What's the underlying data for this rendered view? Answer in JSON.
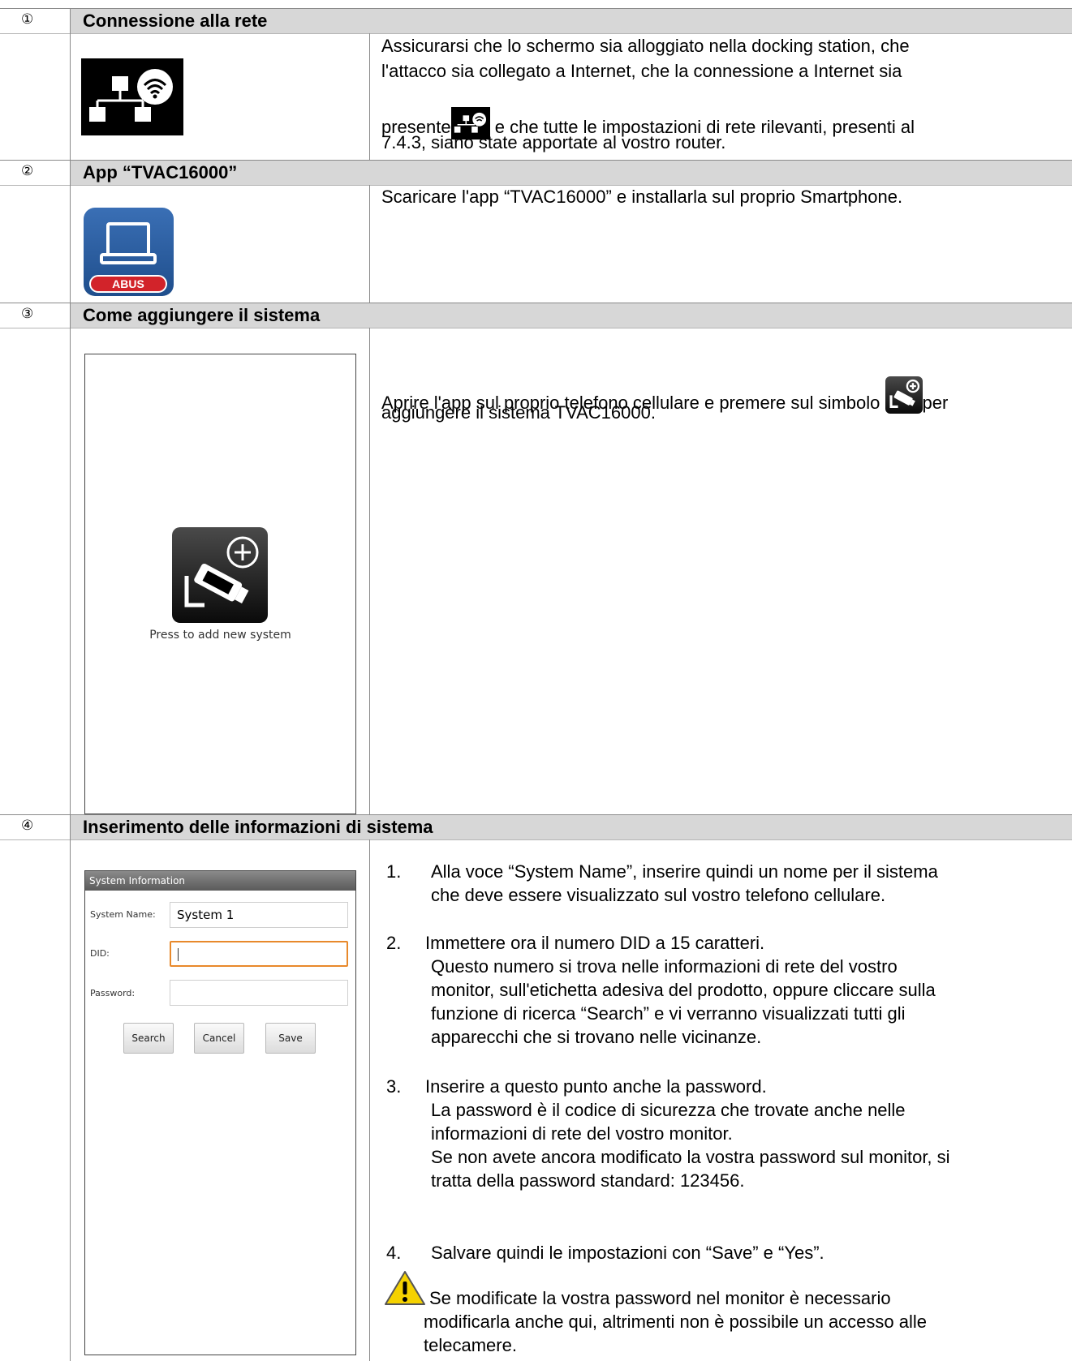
{
  "sections": [
    {
      "number": "①",
      "title": "Connessione alla rete",
      "text_line1": "Assicurarsi che lo schermo sia alloggiato nella docking station, che",
      "text_line2": "l'attacco sia collegato a Internet, che la connessione a Internet sia",
      "text_before_icon": "presente",
      "text_after_icon": " e che tutte le impostazioni di rete rilevanti, presenti al",
      "text_line4": "7.4.3, siano state apportate al vostro router.",
      "icon": "network-wifi-icon"
    },
    {
      "number": "②",
      "title": "App “TVAC16000”",
      "text": "Scaricare l'app “TVAC16000” e installarla sul proprio Smartphone.",
      "icon": "abus-app-icon",
      "app_logo_text": "ABUS"
    },
    {
      "number": "③",
      "title": "Come aggiungere il sistema",
      "text_before_icon": "Aprire l'app sul proprio telefono cellulare e premere sul simbolo ",
      "text_after_icon": "per",
      "text_line2": "aggiungere il sistema TVAC16000.",
      "app_add_label": "Press to add new system",
      "icon": "add-camera-icon"
    },
    {
      "number": "④",
      "title": "Inserimento delle informazioni di sistema",
      "app_form": {
        "title": "System Information",
        "system_name_label": "System Name:",
        "system_name_value": "System 1",
        "did_label": "DID:",
        "did_value": "",
        "password_label": "Password:",
        "password_value": "",
        "search_button": "Search",
        "cancel_button": "Cancel",
        "save_button": "Save"
      },
      "steps": [
        {
          "number": "1.",
          "lines": [
            "Alla voce “System Name”, inserire quindi un nome per il sistema",
            "che deve essere visualizzato sul vostro telefono cellulare."
          ]
        },
        {
          "number": "2.",
          "lines": [
            "Immettere ora il numero DID a 15 caratteri.",
            "Questo numero si trova nelle informazioni di rete del vostro",
            "monitor, sull'etichetta adesiva del prodotto, oppure cliccare sulla",
            "funzione di ricerca “Search” e vi verranno visualizzati tutti gli",
            "apparecchi che si trovano nelle vicinanze."
          ]
        },
        {
          "number": "3.",
          "lines": [
            "Inserire a questo punto anche la password.",
            "La password è il codice di sicurezza che trovate anche nelle",
            "informazioni di rete del vostro monitor.",
            "Se non avete ancora modificato la vostra password sul monitor, si",
            "tratta della password standard: 123456."
          ]
        },
        {
          "number": "4.",
          "lines": [
            "Salvare quindi le impostazioni con “Save” e “Yes”."
          ]
        }
      ],
      "warning_lines": [
        "Se modificate la vostra password nel monitor è necessario",
        "modificarla anche qui, altrimenti non è possibile un accesso alle",
        "telecamere."
      ],
      "warning_icon": "warning-icon"
    }
  ],
  "colors": {
    "header_bg": "#d7d7d7",
    "border": "#8a8a8a",
    "app_blue": "#1f4e8c",
    "abus_red": "#d2232a",
    "orange_focus": "#e8892b",
    "warning_yellow": "#f5d200"
  }
}
